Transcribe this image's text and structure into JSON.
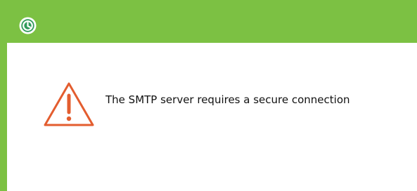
{
  "window": {
    "icon": "app-clock-icon",
    "accent_color": "#7cc143"
  },
  "alert": {
    "icon": "warning-triangle-icon",
    "icon_color": "#e35d2f",
    "message": "The SMTP server requires a secure connection"
  }
}
